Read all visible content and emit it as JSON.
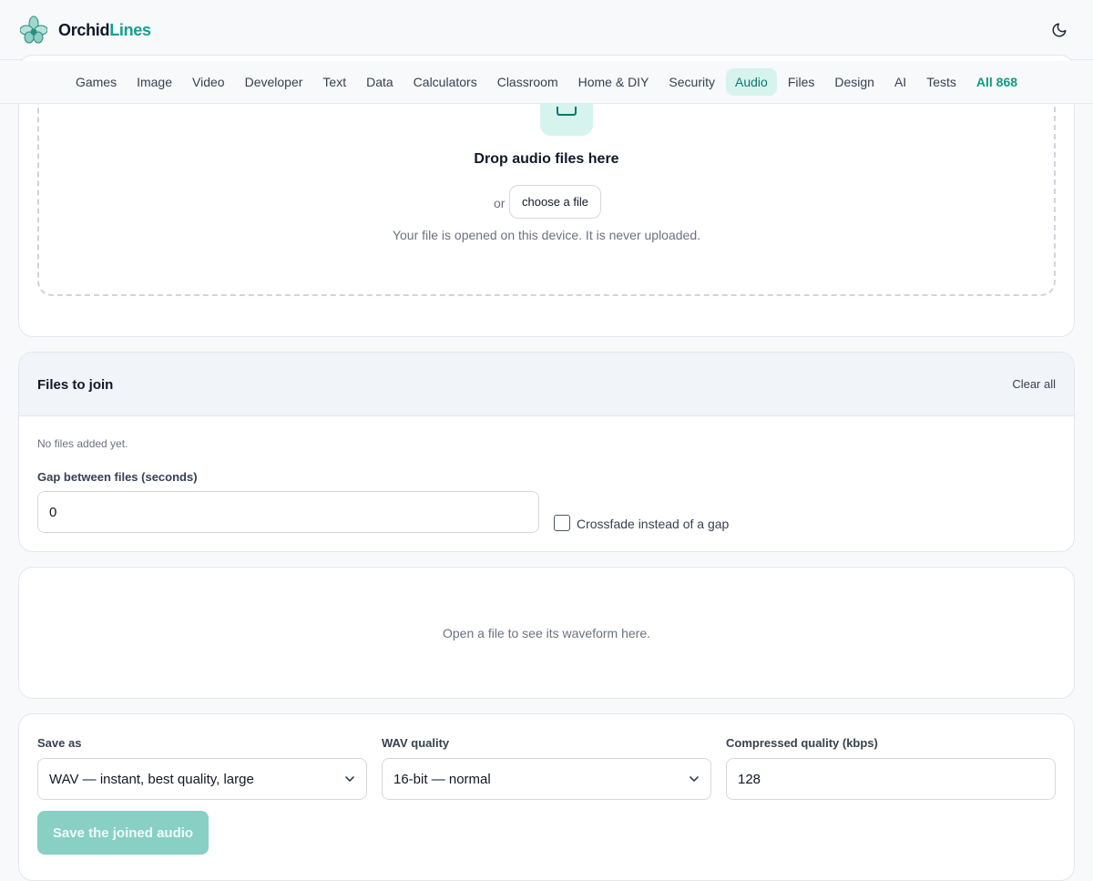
{
  "brand": {
    "name_part1": "Orchid",
    "name_part2": "Lines"
  },
  "nav": {
    "items": [
      "Games",
      "Image",
      "Video",
      "Developer",
      "Text",
      "Data",
      "Calculators",
      "Classroom",
      "Home & DIY",
      "Security",
      "Audio",
      "Files",
      "Design",
      "AI",
      "Tests"
    ],
    "active": "Audio",
    "all_label": "All 868"
  },
  "dropzone": {
    "title": "Drop audio files here",
    "or_text": "or",
    "choose_button": "choose a file",
    "note": "Your file is opened on this device. It is never uploaded."
  },
  "files_card": {
    "title": "Files to join",
    "clear_button": "Clear all",
    "empty_message": "No files added yet.",
    "gap_label": "Gap between files (seconds)",
    "gap_value": "0",
    "crossfade_label": "Crossfade instead of a gap",
    "crossfade_checked": false
  },
  "waveform": {
    "empty_message": "Open a file to see its waveform here."
  },
  "save_card": {
    "save_as_label": "Save as",
    "save_as_value": "WAV — instant, best quality, large",
    "wav_quality_label": "WAV quality",
    "wav_quality_value": "16-bit — normal",
    "compressed_label": "Compressed quality (kbps)",
    "compressed_value": "128",
    "save_button": "Save the joined audio"
  },
  "colors": {
    "accent": "#14a08f",
    "active_bg": "#d7f3ee",
    "button_disabled": "#88cfc4"
  },
  "icons": {
    "logo": "orchid-logo-icon",
    "theme": "moon-icon",
    "upload": "upload-icon",
    "select": "chevron-down-icon"
  }
}
